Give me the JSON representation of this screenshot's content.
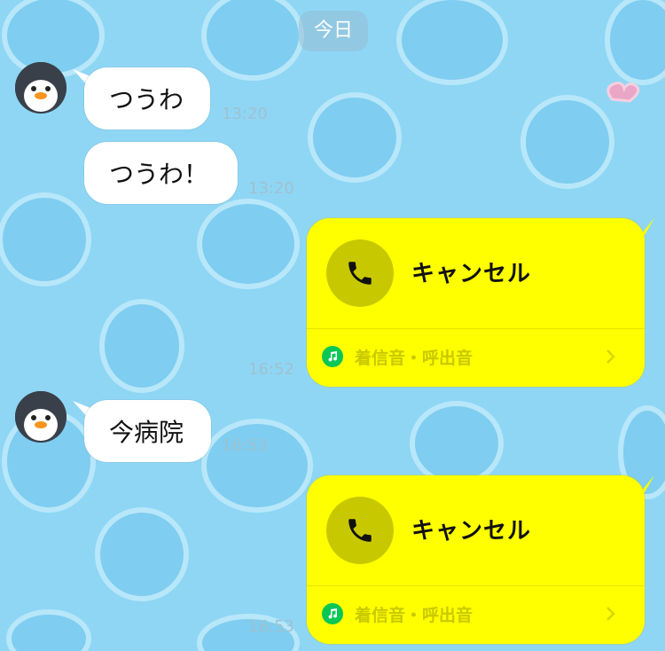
{
  "chat": {
    "date_label": "今日",
    "messages": [
      {
        "type": "text",
        "sender": "incoming",
        "text": "つうわ",
        "time": "13:20"
      },
      {
        "type": "text",
        "sender": "incoming",
        "text": "つうわ！",
        "time": "13:20"
      },
      {
        "type": "call",
        "sender": "outgoing",
        "title": "キャンセル",
        "footer": "着信音・呼出音",
        "time": "16:52"
      },
      {
        "type": "text",
        "sender": "incoming",
        "text": "今病院",
        "time": "16:53"
      },
      {
        "type": "call",
        "sender": "outgoing",
        "title": "キャンセル",
        "footer": "着信音・呼出音",
        "time": "16:53"
      }
    ]
  },
  "icons": {
    "avatar": "penguin-avatar-icon",
    "call": "phone-icon",
    "music": "music-note-icon",
    "chevron": "chevron-right-icon"
  },
  "colors": {
    "background": "#8fd6f5",
    "incoming_bubble": "#ffffff",
    "call_card": "#ffff00",
    "music_badge": "#08c755"
  }
}
